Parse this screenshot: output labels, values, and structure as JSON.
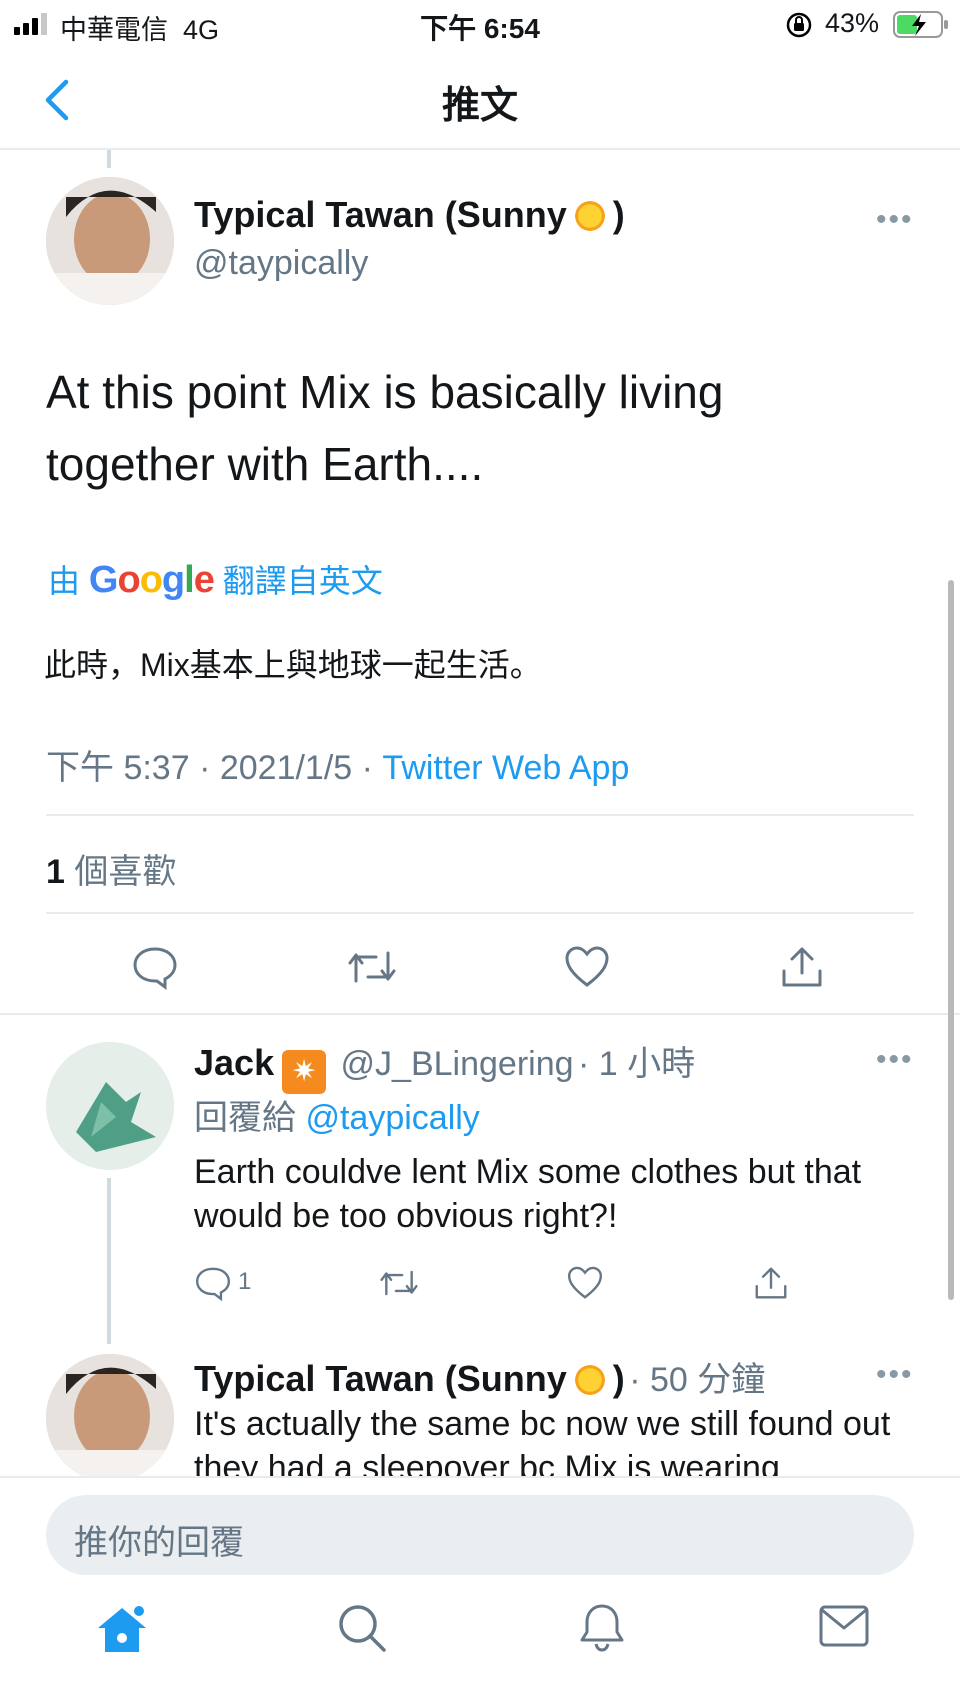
{
  "status_bar": {
    "carrier": "中華電信",
    "network": "4G",
    "time": "下午 6:54",
    "battery": "43%"
  },
  "nav": {
    "title": "推文"
  },
  "main_tweet": {
    "name": "Typical Tawan (Sunny",
    "name_suffix": ")",
    "handle": "@taypically",
    "text": "At this point Mix is basically living together with Earth....",
    "translate_prefix": "由",
    "translate_brand": "Google",
    "translate_suffix": "翻譯自英文",
    "translated_text": "此時，Mix基本上與地球一起生活。",
    "time": "下午 5:37",
    "date": "2021/1/5",
    "app": "Twitter Web App",
    "likes_count": "1",
    "likes_label": "個喜歡"
  },
  "replies": [
    {
      "name": "Jack",
      "handle": "@J_BLingering",
      "age": "1 小時",
      "reply_to_label": "回覆給",
      "reply_to_handle": "@taypically",
      "text": "Earth couldve lent Mix some clothes but that would be too obvious right?!",
      "reply_count": "1"
    },
    {
      "name": "Typical Tawan (Sunny",
      "name_suffix": ")",
      "age": "50 分鐘",
      "text": "It's actually the same bc now we still found out they had a sleepover bc Mix is wearing"
    }
  ],
  "compose": {
    "placeholder": "推你的回覆"
  },
  "tabs": [
    "home",
    "search",
    "notifications",
    "messages"
  ],
  "colors": {
    "accent": "#1d9bf0",
    "secondary_text": "#657786",
    "divider": "#e6ecf0"
  }
}
